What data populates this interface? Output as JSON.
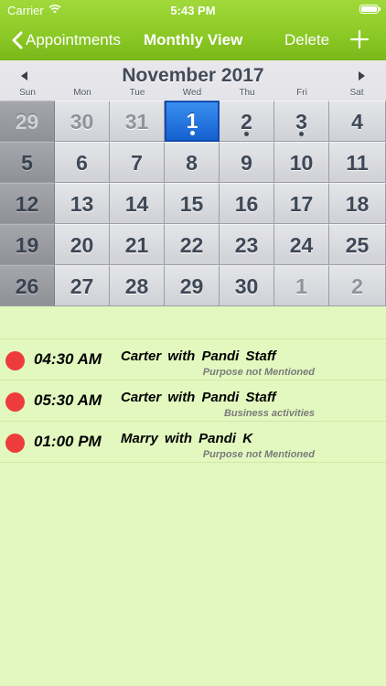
{
  "status": {
    "carrier": "Carrier",
    "time": "5:43 PM"
  },
  "nav": {
    "back_label": "Appointments",
    "title": "Monthly View",
    "delete_label": "Delete",
    "add_icon": "plus-icon"
  },
  "calendar": {
    "month_title": "November 2017",
    "weekdays": [
      "Sun",
      "Mon",
      "Tue",
      "Wed",
      "Thu",
      "Fri",
      "Sat"
    ],
    "weeks": [
      [
        {
          "day": "29",
          "other": true
        },
        {
          "day": "30",
          "other": true
        },
        {
          "day": "31",
          "other": true
        },
        {
          "day": "1",
          "selected": true,
          "dot": true
        },
        {
          "day": "2",
          "dot": true
        },
        {
          "day": "3",
          "dot": true
        },
        {
          "day": "4"
        }
      ],
      [
        {
          "day": "5"
        },
        {
          "day": "6"
        },
        {
          "day": "7"
        },
        {
          "day": "8"
        },
        {
          "day": "9"
        },
        {
          "day": "10"
        },
        {
          "day": "11"
        }
      ],
      [
        {
          "day": "12"
        },
        {
          "day": "13"
        },
        {
          "day": "14"
        },
        {
          "day": "15"
        },
        {
          "day": "16"
        },
        {
          "day": "17"
        },
        {
          "day": "18"
        }
      ],
      [
        {
          "day": "19"
        },
        {
          "day": "20"
        },
        {
          "day": "21"
        },
        {
          "day": "22"
        },
        {
          "day": "23"
        },
        {
          "day": "24"
        },
        {
          "day": "25"
        }
      ],
      [
        {
          "day": "26"
        },
        {
          "day": "27"
        },
        {
          "day": "28"
        },
        {
          "day": "29"
        },
        {
          "day": "30"
        },
        {
          "day": "1",
          "other": true
        },
        {
          "day": "2",
          "other": true
        }
      ]
    ]
  },
  "appointments": [
    {
      "time": "04:30 AM",
      "title": "Carter  with  Pandi Staff",
      "purpose": "Purpose not Mentioned"
    },
    {
      "time": "05:30 AM",
      "title": "Carter  with  Pandi Staff",
      "purpose": "Business activities"
    },
    {
      "time": "01:00 PM",
      "title": "Marry  with  Pandi K",
      "purpose": "Purpose not Mentioned"
    }
  ],
  "colors": {
    "header_green": "#8ac825",
    "background": "#e2f8bf",
    "selected_blue": "#1f73e0",
    "appointment_dot": "#ee3b3b"
  }
}
